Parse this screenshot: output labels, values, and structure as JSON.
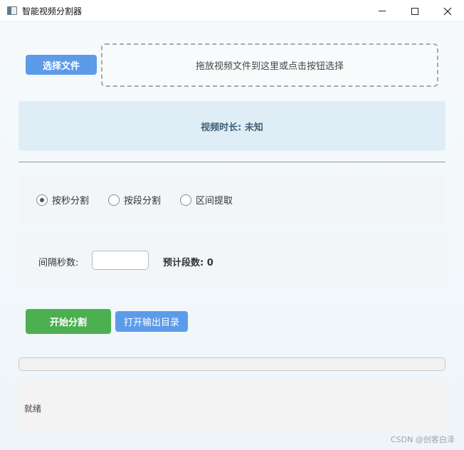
{
  "window": {
    "title": "智能视频分割器"
  },
  "file": {
    "select_label": "选择文件",
    "drop_hint": "拖放视频文件到这里或点击按钮选择"
  },
  "info": {
    "duration": "视频时长: 未知"
  },
  "modes": {
    "by_seconds": "按秒分割",
    "by_segments": "按段分割",
    "range_extract": "区间提取",
    "selected": "按秒分割"
  },
  "params": {
    "interval_label": "间隔秒数:",
    "interval_value": "",
    "estimate": "预计段数: 0"
  },
  "actions": {
    "start_label": "开始分割",
    "open_dir_label": "打开输出目录"
  },
  "progress": {
    "value": 0
  },
  "status": {
    "text": "就绪"
  },
  "watermark": "CSDN @创客白泽",
  "colors": {
    "primary": "#5c9bea",
    "start": "#4caf50"
  }
}
